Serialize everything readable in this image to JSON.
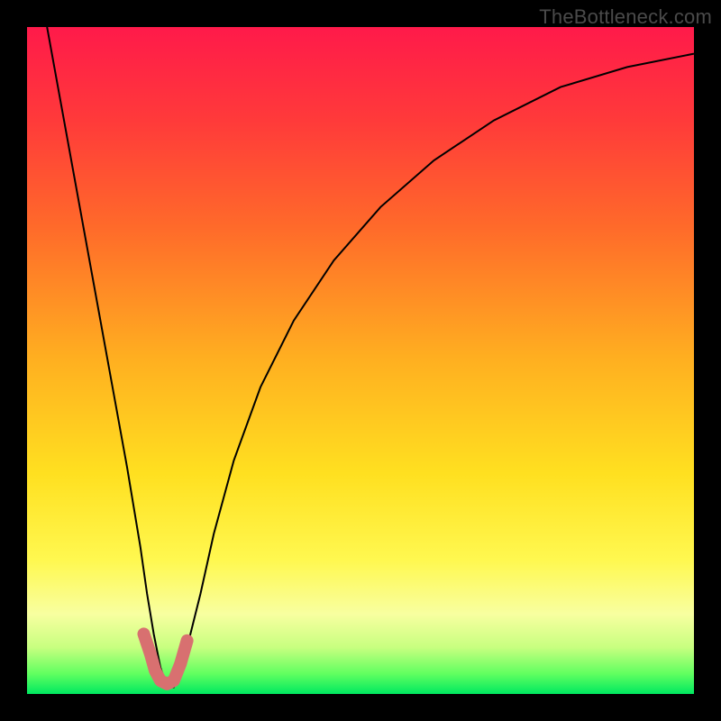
{
  "watermark": "TheBottleneck.com",
  "chart_data": {
    "type": "line",
    "title": "",
    "xlabel": "",
    "ylabel": "",
    "xlim": [
      0,
      100
    ],
    "ylim": [
      0,
      100
    ],
    "grid": false,
    "legend": false,
    "background_gradient": {
      "type": "vertical",
      "stops": [
        {
          "pos": 0.0,
          "color": "#ff1a4a"
        },
        {
          "pos": 0.14,
          "color": "#ff3a3a"
        },
        {
          "pos": 0.3,
          "color": "#ff6a2a"
        },
        {
          "pos": 0.5,
          "color": "#ffb020"
        },
        {
          "pos": 0.67,
          "color": "#ffe020"
        },
        {
          "pos": 0.8,
          "color": "#fff850"
        },
        {
          "pos": 0.88,
          "color": "#f8ffa0"
        },
        {
          "pos": 0.93,
          "color": "#c8ff80"
        },
        {
          "pos": 0.97,
          "color": "#60ff60"
        },
        {
          "pos": 1.0,
          "color": "#00e860"
        }
      ]
    },
    "series": [
      {
        "name": "bottleneck-curve",
        "color": "#000000",
        "width": 2,
        "x": [
          3,
          5,
          7,
          9,
          11,
          13,
          15,
          17,
          18,
          19,
          20,
          21,
          22,
          23,
          24,
          26,
          28,
          31,
          35,
          40,
          46,
          53,
          61,
          70,
          80,
          90,
          100
        ],
        "y": [
          100,
          89,
          78,
          67,
          56,
          45,
          34,
          22,
          15,
          9,
          4,
          1,
          1,
          3,
          7,
          15,
          24,
          35,
          46,
          56,
          65,
          73,
          80,
          86,
          91,
          94,
          96
        ]
      },
      {
        "name": "highlight-bottom",
        "color": "#d87070",
        "width": 14,
        "cap": "round",
        "x": [
          17.5,
          18.5,
          19.2,
          20.0,
          21.0,
          22.0,
          23.0,
          24.0
        ],
        "y": [
          9.0,
          6.0,
          3.5,
          2.0,
          1.5,
          2.0,
          4.5,
          8.0
        ]
      }
    ]
  }
}
